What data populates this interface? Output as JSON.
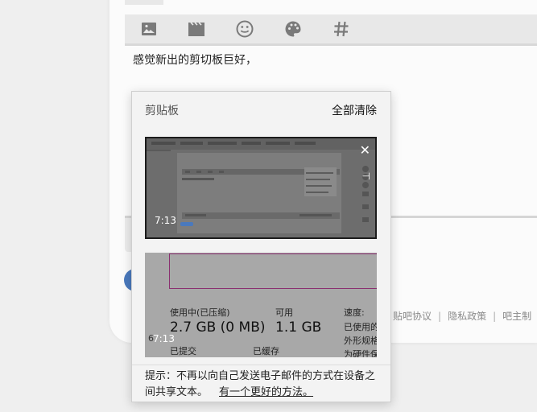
{
  "toolbar": {
    "icons": [
      "image-icon",
      "video-icon",
      "emoji-icon",
      "palette-icon",
      "hashtag-icon"
    ]
  },
  "editor": {
    "text": "感觉新出的剪切板巨好，"
  },
  "footer": {
    "links": [
      "贴吧协议",
      "隐私政策",
      "吧主制"
    ]
  },
  "clipboard": {
    "title": "剪贴板",
    "clear_all": "全部清除",
    "items": [
      {
        "kind": "screenshot",
        "duration": "7:13"
      },
      {
        "kind": "screenshot",
        "duration": "7:13",
        "content": {
          "in_use_label": "使用中(已压缩)",
          "in_use_value": "2.7 GB (0 MB)",
          "available_label": "可用",
          "available_value": "1.1 GB",
          "speed_label": "速度:",
          "used_label": "已使用的",
          "form_factor_label": "外形规格",
          "hw_reserved_label": "为硬件保",
          "committed_label": "已提交",
          "cached_label": "已缓存",
          "partial_char": "6"
        }
      }
    ],
    "hint": "提示：不再以向自己发送电子邮件的方式在设备之间共享文本。",
    "hint_link": "有一个更好的方法。"
  },
  "colors": {
    "accent_blue": "#4a79bd",
    "panel_bg": "#f3f3f3"
  }
}
